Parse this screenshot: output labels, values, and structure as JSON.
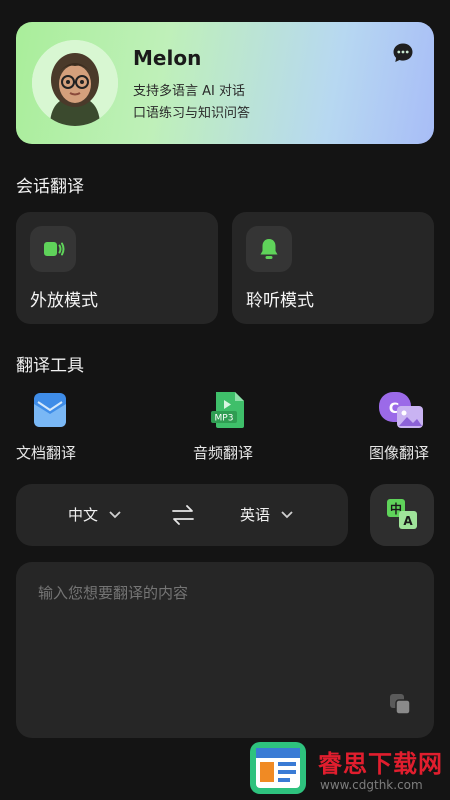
{
  "profile": {
    "name": "Melon",
    "tagline1": "支持多语言 AI 对话",
    "tagline2": "口语练习与知识问答"
  },
  "sections": {
    "conversation": "会话翻译",
    "tools": "翻译工具"
  },
  "modes": [
    {
      "label": "外放模式",
      "icon": "speaker-icon"
    },
    {
      "label": "聆听模式",
      "icon": "bell-icon"
    }
  ],
  "tools": [
    {
      "label": "文档翻译",
      "icon": "mail-document-icon"
    },
    {
      "label": "音频翻译",
      "icon": "mp3-file-icon",
      "badge": "MP3"
    },
    {
      "label": "图像翻译",
      "icon": "image-icon"
    }
  ],
  "languages": {
    "source": "中文",
    "target": "英语"
  },
  "translate_button": {
    "zh": "中",
    "en": "A"
  },
  "input": {
    "placeholder": "输入您想要翻译的内容"
  },
  "watermark": {
    "text": "睿思下载网",
    "url": "www.cdgthk.com"
  },
  "colors": {
    "accent_green": "#5fd35a",
    "background": "#141414",
    "card": "#262626"
  }
}
